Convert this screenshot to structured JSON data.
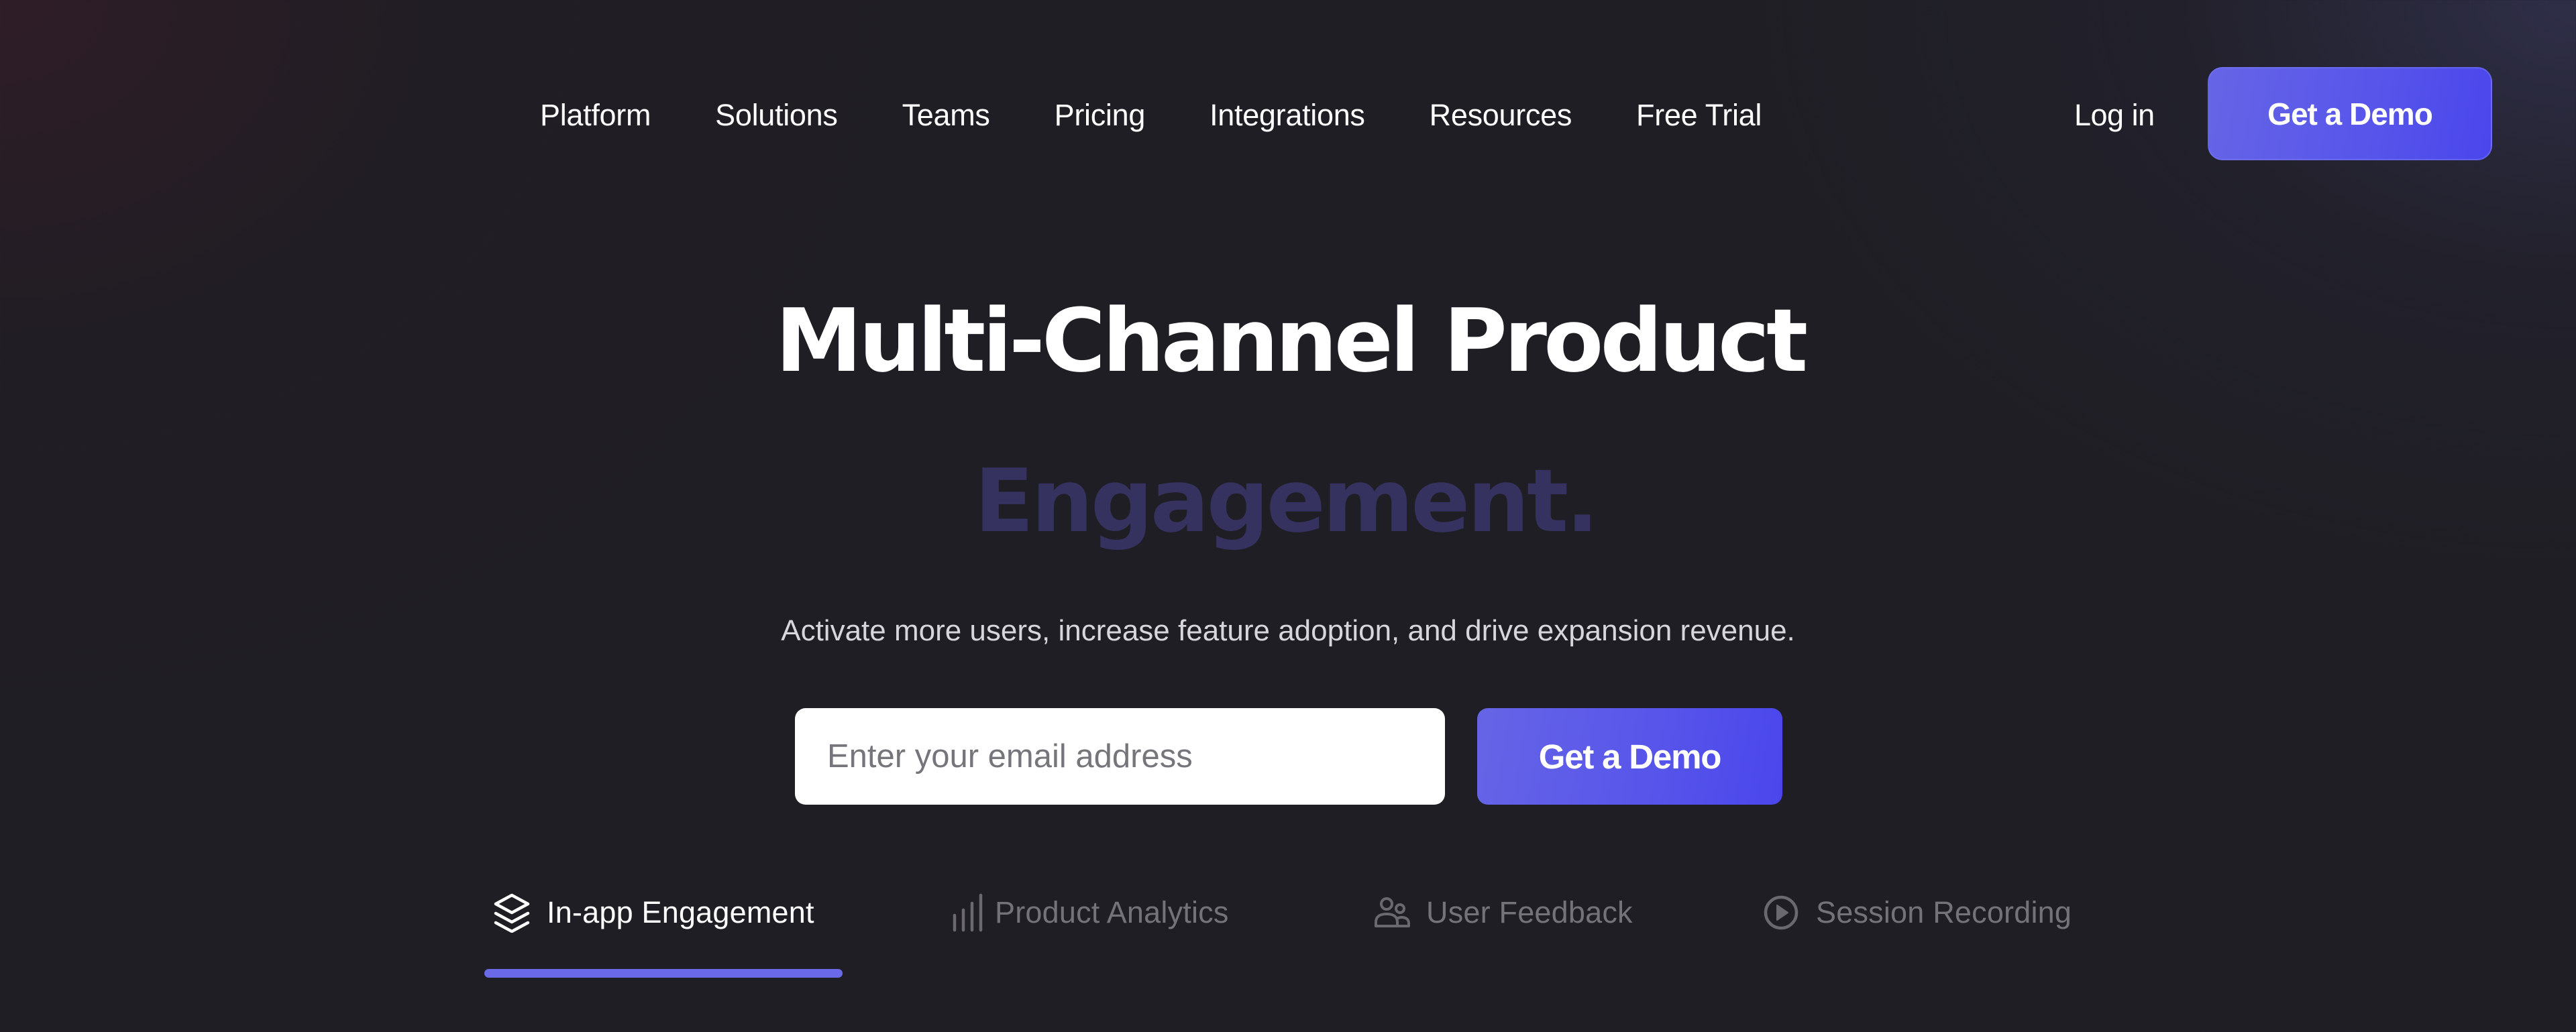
{
  "nav": {
    "links": [
      {
        "label": "Platform"
      },
      {
        "label": "Solutions"
      },
      {
        "label": "Teams"
      },
      {
        "label": "Pricing"
      },
      {
        "label": "Integrations"
      },
      {
        "label": "Resources"
      },
      {
        "label": "Free Trial"
      }
    ],
    "login_label": "Log in",
    "demo_button_label": "Get a Demo"
  },
  "hero": {
    "title_line1": "Multi-Channel Product",
    "title_line2": "Engagement.",
    "subtitle": "Activate more users, increase feature adoption, and drive expansion revenue.",
    "email_input": {
      "value": "",
      "placeholder": "Enter your email address"
    },
    "demo_button_label": "Get a Demo"
  },
  "tabs": {
    "active_index": 0,
    "items": [
      {
        "label": "In-app Engagement",
        "icon": "layers-icon",
        "active": true
      },
      {
        "label": "Product Analytics",
        "icon": "bar-chart-icon",
        "active": false
      },
      {
        "label": "User Feedback",
        "icon": "users-icon",
        "active": false
      },
      {
        "label": "Session Recording",
        "icon": "play-circle-icon",
        "active": false
      }
    ]
  },
  "colors": {
    "background": "#1f1e24",
    "accent": "#5b59ea",
    "accent_gradient_start": "#6665e6",
    "accent_gradient_end": "#4a46ec",
    "tab_underline": "#6a69e8",
    "title_secondary": "#35325f",
    "text_primary": "#ffffff",
    "text_muted": "#74737a",
    "subtitle": "#d6d6dc"
  }
}
